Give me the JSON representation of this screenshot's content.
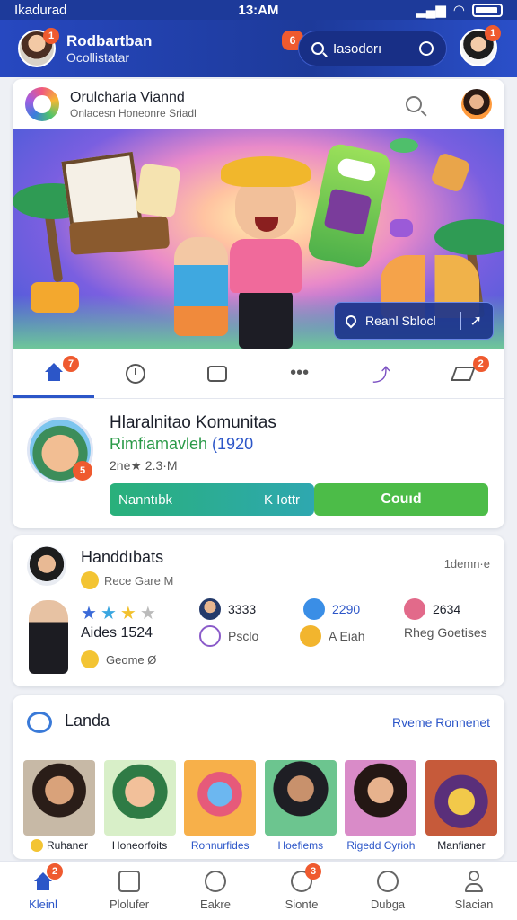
{
  "status_bar": {
    "carrier": "Ikadurad",
    "time": "13:AM"
  },
  "header": {
    "name": "Rodbartban",
    "handle": "Ocollistatar",
    "avatar_badge": "1",
    "notif_badge": "6",
    "search_placeholder": "Iasodorı",
    "right_avatar_badge": "1"
  },
  "main_card": {
    "title": "Orulcharia Viannd",
    "subtitle": "Onlacesn Honeonre Sriadl",
    "banner_button_label": "Reanl Sblocl",
    "tab_badges": {
      "home": "7",
      "send": "2"
    }
  },
  "profile": {
    "title": "Hlaralnitao Komunitas",
    "subtitle_green": "Rimfiamavleh",
    "subtitle_blue": "(1920",
    "meta": "2ne★ 2.3·M",
    "badge": "5",
    "btn_left_label": "Nanntıbk",
    "btn_left_right": "K Iottr",
    "btn_right_label": "Couıd"
  },
  "hand_card": {
    "title": "Handdıbats",
    "sub": "Rece Gare M",
    "right_text": "1demn·e",
    "rating": 3.5,
    "aide": "Aides 1524",
    "geo": "Geome Ø",
    "stats": [
      {
        "value": "3333",
        "label": "Psclo"
      },
      {
        "value": "2290",
        "label": "A Eiah"
      },
      {
        "value": "2634",
        "label": "Rheg Goetises"
      }
    ]
  },
  "landa": {
    "title": "Landa",
    "link": "Rveme Ronnenet",
    "items": [
      {
        "caption": "Ruhaner"
      },
      {
        "caption": "Honeorfoits"
      },
      {
        "caption": "Ronnurfides"
      },
      {
        "caption": "Hoefiems"
      },
      {
        "caption": "Rigedd Cyrioh"
      },
      {
        "caption": "Manfianer"
      }
    ]
  },
  "bottom_nav": [
    {
      "label": "Kleinl",
      "badge": "2"
    },
    {
      "label": "Plolufer"
    },
    {
      "label": "Eakre"
    },
    {
      "label": "Sionte",
      "badge": "3"
    },
    {
      "label": "Dubga"
    },
    {
      "label": "Slacian"
    }
  ],
  "colors": {
    "primary": "#1d3a9a",
    "accent": "#2c56c8",
    "badge": "#ef5a2f",
    "green": "#4cbc48"
  }
}
